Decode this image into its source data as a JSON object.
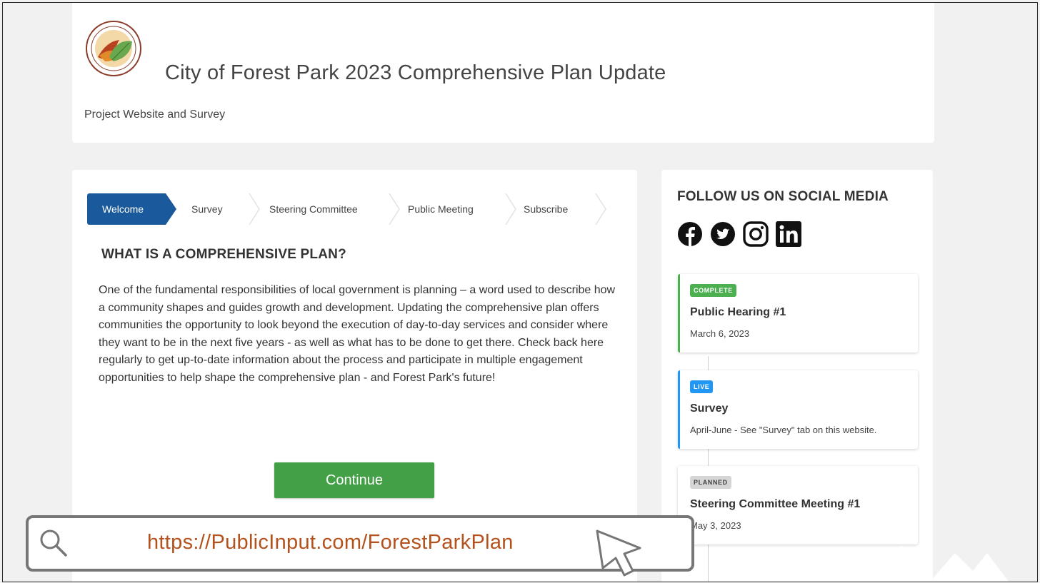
{
  "header": {
    "seal_text": "THE CITY OF FOREST PARK",
    "title": "City of Forest Park 2023 Comprehensive Plan Update",
    "subtitle": "Project Website and Survey"
  },
  "steps": [
    {
      "label": "Welcome",
      "active": true
    },
    {
      "label": "Survey",
      "active": false
    },
    {
      "label": "Steering Committee",
      "active": false
    },
    {
      "label": "Public Meeting",
      "active": false
    },
    {
      "label": "Subscribe",
      "active": false
    }
  ],
  "main": {
    "title": "WHAT IS A COMPREHENSIVE PLAN?",
    "body": "One of the fundamental responsibilities of local government is planning – a word used to describe how a community shapes and guides growth and development. Updating the comprehensive plan offers communities the opportunity to look beyond the execution of day-to-day services and consider where they want to be in the next five years - as well as what has to be done to get there. Check back here regularly to get up-to-date information about the process and participate in multiple engagement opportunities to help shape the comprehensive plan - and Forest Park's future!",
    "continue_label": "Continue"
  },
  "sidebar": {
    "follow_title": "FOLLOW US ON SOCIAL MEDIA",
    "socials": [
      "facebook-icon",
      "twitter-icon",
      "instagram-icon",
      "linkedin-icon"
    ],
    "events": [
      {
        "status": "COMPLETE",
        "title": "Public Hearing #1",
        "date": "March 6, 2023",
        "color": "#4caf50"
      },
      {
        "status": "LIVE",
        "title": "Survey",
        "date": "April-June - See \"Survey\" tab on this website.",
        "color": "#2196f3"
      },
      {
        "status": "PLANNED",
        "title": "Steering Committee Meeting #1",
        "date": "May 3, 2023",
        "color": "#cfcfcf"
      }
    ]
  },
  "overlay": {
    "url": "https://PublicInput.com/ForestParkPlan",
    "url_color": "#b5511c"
  },
  "colors": {
    "primary": "#1a5a9c",
    "continue": "#43a047"
  }
}
